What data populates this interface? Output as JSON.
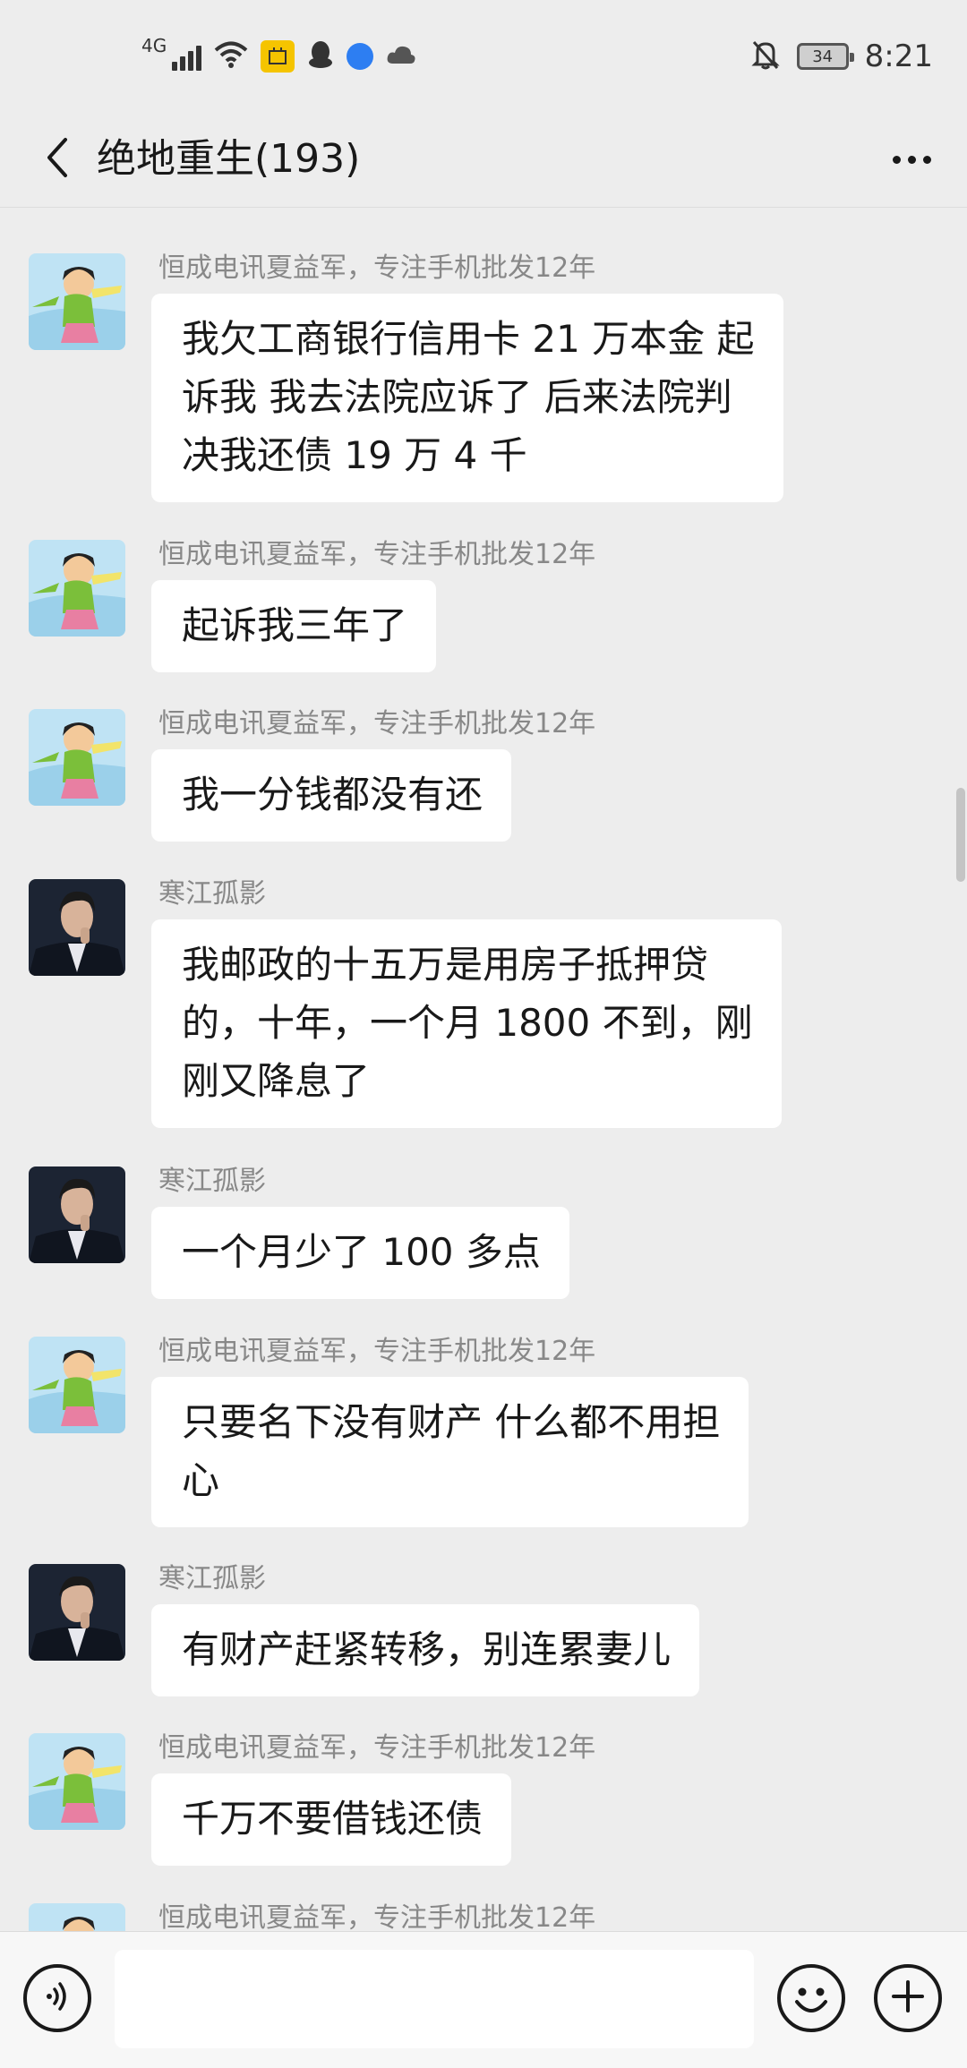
{
  "status_bar": {
    "network": "4G",
    "battery": "34",
    "time": "8:21",
    "icons": [
      "signal-icon",
      "wifi-icon",
      "app-badge-icon",
      "qq-penguin-icon",
      "browser-icon",
      "cloud-icon",
      "mute-bell-icon",
      "battery-icon"
    ]
  },
  "header": {
    "title": "绝地重生(193)",
    "back_icon": "chevron-left-icon",
    "more_icon": "more-dots-icon"
  },
  "messages": [
    {
      "sender": "恒成电讯夏益军，专注手机批发12年",
      "avatar": "cartoon-avatar",
      "lines": [
        "我欠工商银行信用卡 21 万本金  起",
        "诉我  我去法院应诉了  后来法院判",
        "决我还债 19 万 4 千"
      ]
    },
    {
      "sender": "恒成电讯夏益军，专注手机批发12年",
      "avatar": "cartoon-avatar",
      "lines": [
        "起诉我三年了"
      ]
    },
    {
      "sender": "恒成电讯夏益军，专注手机批发12年",
      "avatar": "cartoon-avatar",
      "lines": [
        "我一分钱都没有还"
      ]
    },
    {
      "sender": "寒江孤影",
      "avatar": "photo-avatar",
      "lines": [
        "我邮政的十五万是用房子抵押贷",
        "的，十年，一个月 1800 不到，刚",
        "刚又降息了"
      ]
    },
    {
      "sender": "寒江孤影",
      "avatar": "photo-avatar",
      "lines": [
        "一个月少了 100 多点"
      ]
    },
    {
      "sender": "恒成电讯夏益军，专注手机批发12年",
      "avatar": "cartoon-avatar",
      "lines": [
        "只要名下没有财产  什么都不用担",
        "心"
      ]
    },
    {
      "sender": "寒江孤影",
      "avatar": "photo-avatar",
      "lines": [
        "有财产赶紧转移，别连累妻儿"
      ]
    },
    {
      "sender": "恒成电讯夏益军，专注手机批发12年",
      "avatar": "cartoon-avatar",
      "lines": [
        "千万不要借钱还债"
      ]
    },
    {
      "sender": "恒成电讯夏益军，专注手机批发12年",
      "avatar": "cartoon-avatar",
      "lines": []
    }
  ],
  "input_bar": {
    "voice_icon": "voice-icon",
    "input_value": "",
    "emoji_icon": "emoji-icon",
    "plus_icon": "plus-icon"
  },
  "colors": {
    "background": "#ededed",
    "bubble": "#ffffff",
    "sender_text": "#888888",
    "message_text": "#191919"
  }
}
